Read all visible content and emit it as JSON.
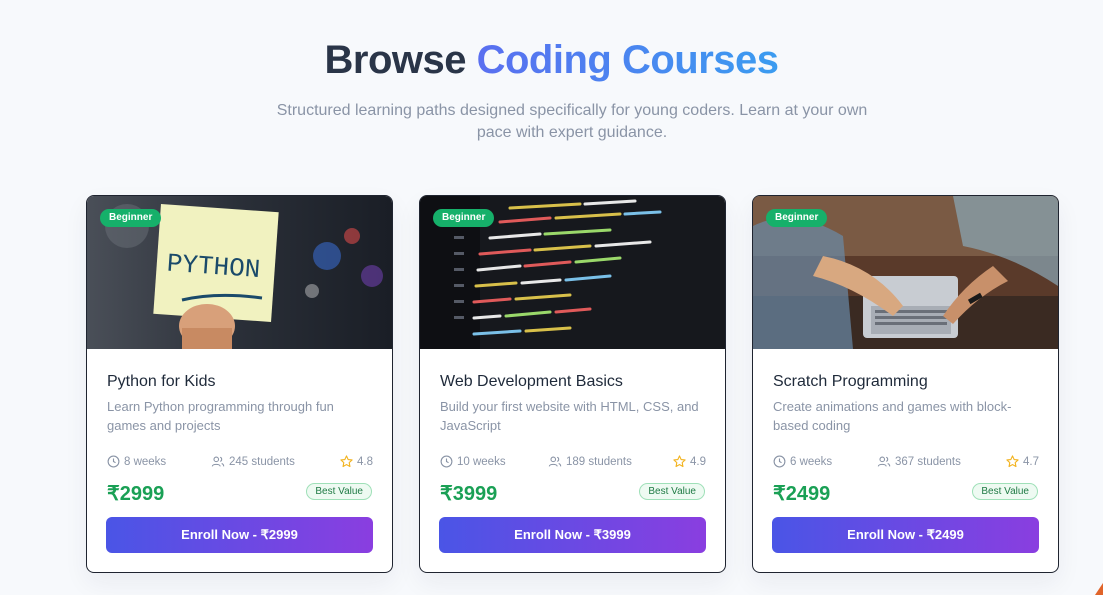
{
  "heading": {
    "prefix": "Browse",
    "accent": "Coding Courses"
  },
  "subtitle": "Structured learning paths designed specifically for young coders. Learn at your own pace with expert guidance.",
  "colors": {
    "accent_start": "#5a6ff0",
    "accent_end": "#3b9cf0",
    "badge": "#16b06a",
    "price": "#1aa055",
    "button_start": "#4a55e6",
    "button_end": "#8a3ee0",
    "star": "#f2b21c"
  },
  "courses": [
    {
      "badge": "Beginner",
      "image": "python-sticky-note-photo",
      "title": "Python for Kids",
      "description": "Learn Python programming through fun games and projects",
      "duration": "8 weeks",
      "students": "245 students",
      "rating": "4.8",
      "price": "₹2999",
      "tag": "Best Value",
      "enroll": "Enroll Now - ₹2999"
    },
    {
      "badge": "Beginner",
      "image": "code-on-screen-photo",
      "title": "Web Development Basics",
      "description": "Build your first website with HTML, CSS, and JavaScript",
      "duration": "10 weeks",
      "students": "189 students",
      "rating": "4.9",
      "price": "₹3999",
      "tag": "Best Value",
      "enroll": "Enroll Now - ₹3999"
    },
    {
      "badge": "Beginner",
      "image": "hands-on-laptop-photo",
      "title": "Scratch Programming",
      "description": "Create animations and games with block-based coding",
      "duration": "6 weeks",
      "students": "367 students",
      "rating": "4.7",
      "price": "₹2499",
      "tag": "Best Value",
      "enroll": "Enroll Now - ₹2499"
    }
  ]
}
